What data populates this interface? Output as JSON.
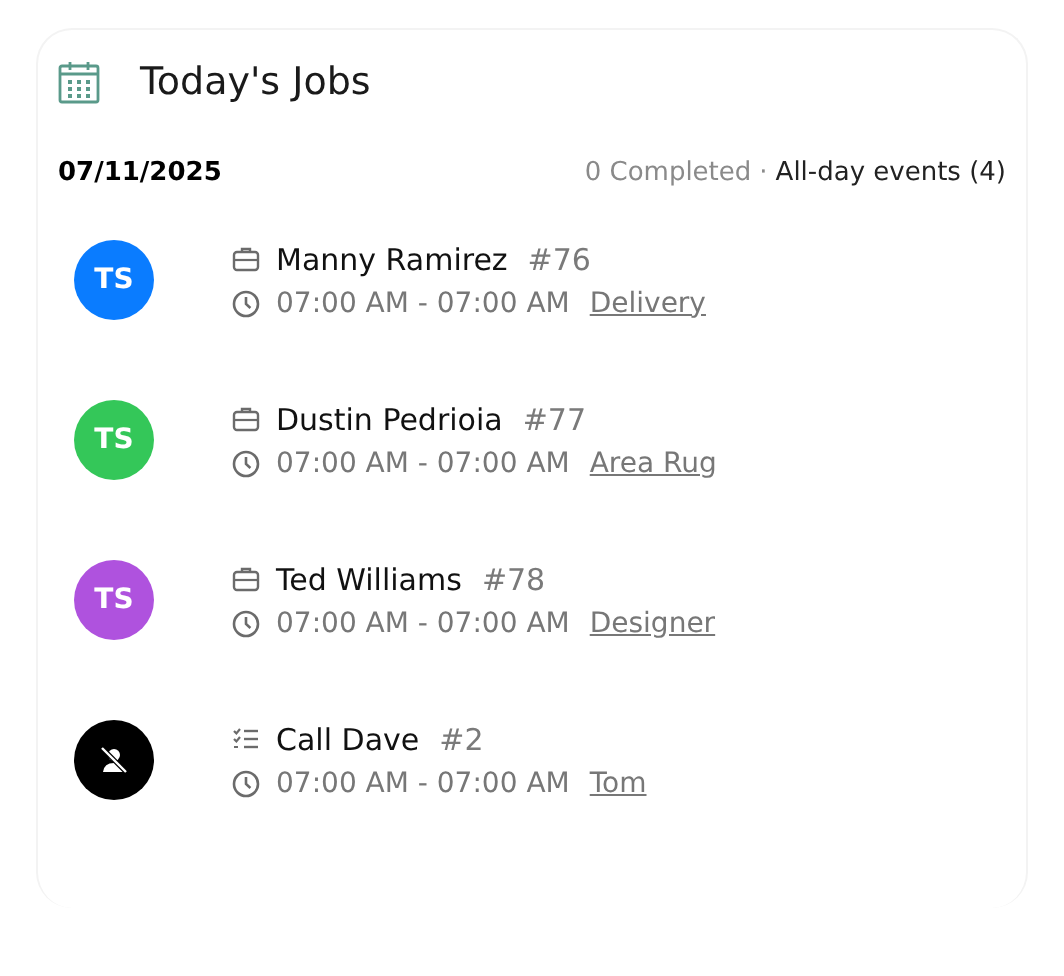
{
  "header": {
    "title": "Today's Jobs"
  },
  "summary": {
    "date": "07/11/2025",
    "completed": "0 Completed",
    "separator": "·",
    "all_day": "All-day events (4)"
  },
  "jobs": [
    {
      "avatar": {
        "kind": "initials",
        "initials": "TS",
        "color": "#0a7cff"
      },
      "kind": "job",
      "name": "Manny Ramirez",
      "number": "#76",
      "time": "07:00 AM - 07:00 AM",
      "tag": "Delivery"
    },
    {
      "avatar": {
        "kind": "initials",
        "initials": "TS",
        "color": "#34c759"
      },
      "kind": "job",
      "name": "Dustin Pedrioia",
      "number": "#77",
      "time": "07:00 AM - 07:00 AM",
      "tag": "Area Rug"
    },
    {
      "avatar": {
        "kind": "initials",
        "initials": "TS",
        "color": "#af52de"
      },
      "kind": "job",
      "name": "Ted Williams",
      "number": "#78",
      "time": "07:00 AM - 07:00 AM",
      "tag": "Designer"
    },
    {
      "avatar": {
        "kind": "unassigned",
        "color": "#000000"
      },
      "kind": "task",
      "name": "Call Dave",
      "number": "#2",
      "time": "07:00 AM - 07:00 AM",
      "tag": "Tom"
    }
  ]
}
